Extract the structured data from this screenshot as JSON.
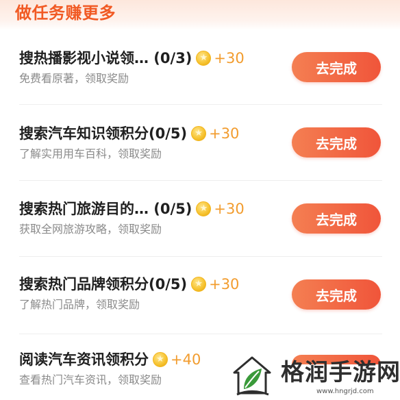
{
  "header": {
    "title": "做任务赚更多"
  },
  "tasks": [
    {
      "title": "搜热播影视小说领… (0/3)",
      "reward": "+30",
      "subtitle": "免费看原著，领取奖励",
      "button": "去完成"
    },
    {
      "title": "搜索汽车知识领积分(0/5)",
      "reward": "+30",
      "subtitle": "了解实用用车百科，领取奖励",
      "button": "去完成"
    },
    {
      "title": "搜索热门旅游目的… (0/5)",
      "reward": "+30",
      "subtitle": "获取全网旅游攻略，领取奖励",
      "button": "去完成"
    },
    {
      "title": "搜索热门品牌领积分(0/5)",
      "reward": "+30",
      "subtitle": "了解热门品牌，领取奖励",
      "button": "去完成"
    },
    {
      "title": "阅读汽车资讯领积分",
      "reward": "+40",
      "subtitle": "查看热门汽车资讯，领取奖励",
      "button": ""
    }
  ],
  "watermark": {
    "text": "格润手游网",
    "url": "www.hngrjd.com"
  },
  "colors": {
    "accent": "#f15a24",
    "button": "#f0553a",
    "reward": "#f29c2e",
    "coin": "#f6c22e"
  },
  "icons": {
    "coin": "coin-icon",
    "logo": "house-leaf-logo-icon"
  }
}
